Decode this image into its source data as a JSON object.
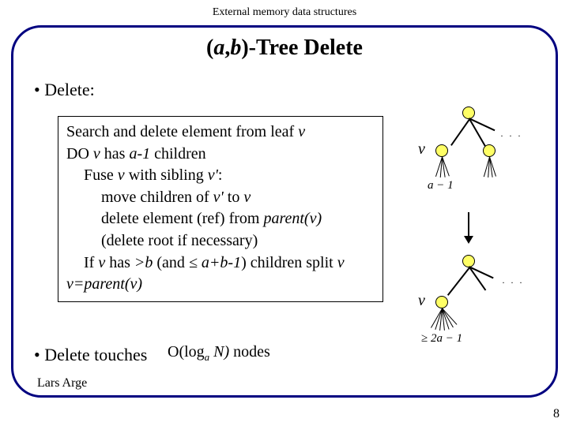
{
  "header": "External memory data structures",
  "title_prefix": "(",
  "title_a": "a",
  "title_comma": ",",
  "title_b": "b",
  "title_suffix": ")-Tree Delete",
  "bullet_delete": "• Delete:",
  "algo": {
    "l1a": "Search and delete element from leaf ",
    "l1v": "v",
    "l2a": "DO ",
    "l2v": "v",
    "l2b": " has ",
    "l2c": "a-1",
    "l2d": " children",
    "l3a": "Fuse ",
    "l3v": "v",
    "l3b": " with sibling ",
    "l3vp": "v'",
    "l3c": ":",
    "l4a": "move children of ",
    "l4vp": "v'",
    "l4b": " to ",
    "l4v": "v",
    "l5a": "delete element (ref) from ",
    "l5p": "parent(v)",
    "l6": "(delete root if necessary)",
    "l7a": "If ",
    "l7v": "v",
    "l7b": " has ",
    "l7c": ">b",
    "l7d": " (and ",
    "l7e": "≤ a+b-1",
    "l7f": ") children split ",
    "l7v2": "v",
    "l8a": "v=parent(v)"
  },
  "bullet_touches_a": "• Delete touches",
  "bullet_touches_math": "O(log",
  "bullet_touches_sub": "a",
  "bullet_touches_N": " N)",
  "bullet_touches_b": " nodes",
  "diag": {
    "v": "v",
    "am1": "a − 1",
    "ge2am1": "≥ 2a − 1",
    "dots": "· · ·"
  },
  "footer": {
    "author": "Lars Arge",
    "page": "8"
  }
}
